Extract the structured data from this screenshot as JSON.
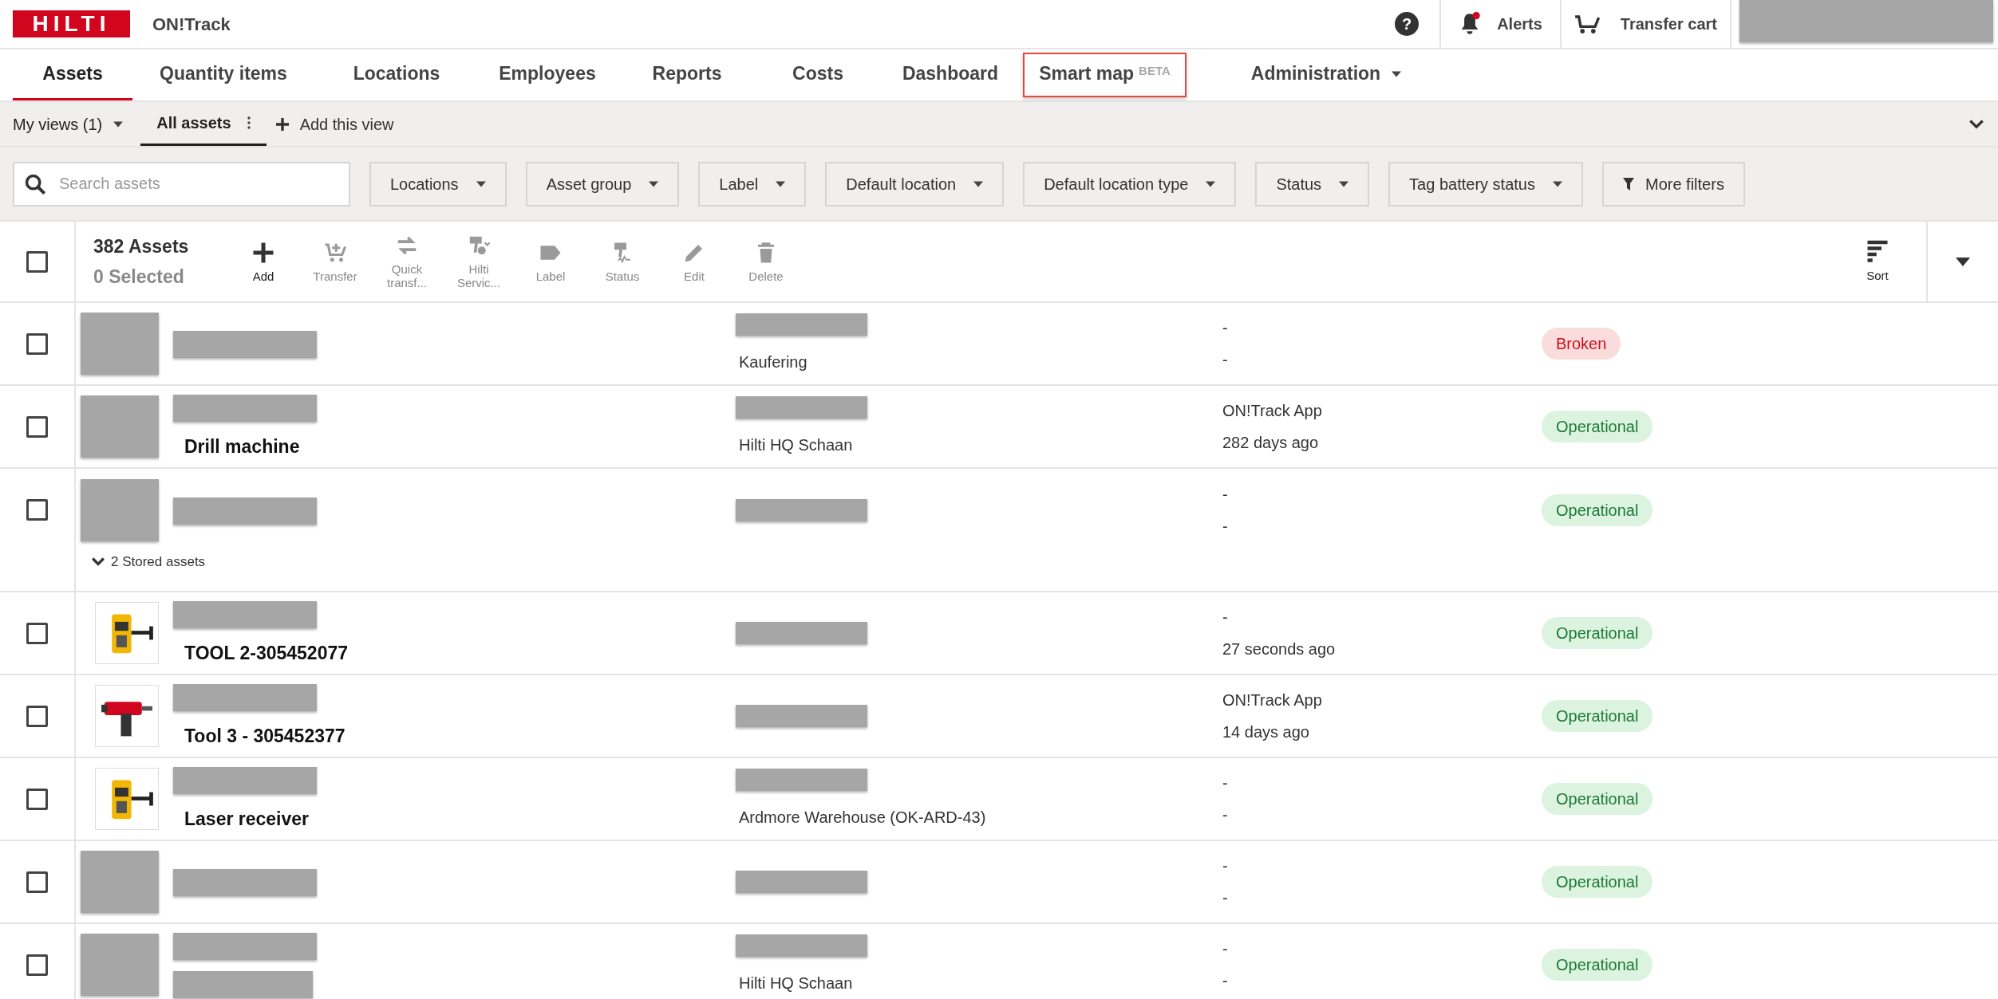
{
  "header": {
    "logo": "HILTI",
    "help": "?",
    "app_name": "ON!Track",
    "alerts": {
      "label": "Alerts",
      "unread": true
    },
    "transfer_cart": "Transfer cart",
    "user": {
      "kind": "redacted"
    }
  },
  "tabs": [
    {
      "label": "Assets",
      "selected": true
    },
    {
      "label": "Quantity items",
      "selected": false
    },
    {
      "label": "Locations",
      "selected": false
    },
    {
      "label": "Employees",
      "selected": false
    },
    {
      "label": "Reports",
      "selected": false
    },
    {
      "label": "Costs",
      "selected": false
    },
    {
      "label": "Dashboard",
      "selected": false
    },
    {
      "label": "Smart map",
      "badge": "BETA",
      "selected": false,
      "outlined": true
    },
    {
      "label": "Administration",
      "selected": false,
      "dropdown": true
    }
  ],
  "views": {
    "my_views": "My views (1)",
    "items": [
      {
        "label": "All assets",
        "selected": true
      }
    ],
    "add_view": "Add this view"
  },
  "filters": {
    "search": {
      "placeholder": "Search assets"
    },
    "dropdowns": [
      "Locations",
      "Asset group",
      "Label",
      "Default location",
      "Default location type",
      "Status",
      "Tag battery status"
    ],
    "more_filters": "More filters"
  },
  "toolbar": {
    "select_all": false,
    "count": "382 Assets",
    "selected_count": "0 Selected",
    "actions": [
      {
        "kind": "add",
        "label": "Add",
        "disabled": false
      },
      {
        "kind": "transfer",
        "label": "Transfer",
        "disabled": true
      },
      {
        "kind": "quick",
        "label": "Quick transf...",
        "disabled": true
      },
      {
        "kind": "service",
        "label": "Hilti Servic...",
        "disabled": true
      },
      {
        "kind": "label",
        "label": "Label",
        "disabled": true
      },
      {
        "kind": "status",
        "label": "Status",
        "disabled": true
      },
      {
        "kind": "edit",
        "label": "Edit",
        "disabled": true
      },
      {
        "kind": "delete",
        "label": "Delete",
        "disabled": true
      }
    ],
    "sort": "Sort"
  },
  "rows": [
    {
      "selected": false,
      "image": {
        "kind": "redacted"
      },
      "name": [
        {
          "kind": "redacted"
        }
      ],
      "location": [
        {
          "kind": "redacted"
        },
        {
          "kind": "text",
          "text": "Kaufering"
        }
      ],
      "info": [
        "-",
        "-"
      ],
      "status": {
        "text": "Broken",
        "kind": "broken"
      }
    },
    {
      "selected": false,
      "image": {
        "kind": "redacted"
      },
      "name": [
        {
          "kind": "redacted"
        },
        {
          "kind": "text",
          "text": "Drill machine"
        }
      ],
      "location": [
        {
          "kind": "redacted"
        },
        {
          "kind": "text",
          "text": "Hilti HQ Schaan"
        }
      ],
      "info": [
        "ON!Track App",
        "282 days ago"
      ],
      "status": {
        "text": "Operational",
        "kind": "operational"
      }
    },
    {
      "selected": false,
      "image": {
        "kind": "redacted"
      },
      "name": [
        {
          "kind": "redacted"
        }
      ],
      "location": [
        {
          "kind": "redacted"
        }
      ],
      "info": [
        "-",
        "-"
      ],
      "status": {
        "text": "Operational",
        "kind": "operational"
      },
      "stored_assets": {
        "label": "2 Stored assets",
        "expanded": false
      }
    },
    {
      "selected": false,
      "image": {
        "kind": "laser"
      },
      "name": [
        {
          "kind": "redacted"
        },
        {
          "kind": "text",
          "text": "TOOL 2-305452077"
        }
      ],
      "location": [
        {
          "kind": "redacted"
        }
      ],
      "info": [
        "-",
        "27 seconds ago"
      ],
      "status": {
        "text": "Operational",
        "kind": "operational"
      }
    },
    {
      "selected": false,
      "image": {
        "kind": "drill"
      },
      "name": [
        {
          "kind": "redacted"
        },
        {
          "kind": "text",
          "text": "Tool 3 - 305452377"
        }
      ],
      "location": [
        {
          "kind": "redacted"
        }
      ],
      "info": [
        "ON!Track App",
        "14 days ago"
      ],
      "status": {
        "text": "Operational",
        "kind": "operational"
      }
    },
    {
      "selected": false,
      "image": {
        "kind": "laser"
      },
      "name": [
        {
          "kind": "redacted"
        },
        {
          "kind": "text",
          "text": "Laser receiver"
        }
      ],
      "location": [
        {
          "kind": "redacted"
        },
        {
          "kind": "text",
          "text": "Ardmore Warehouse (OK-ARD-43)"
        }
      ],
      "info": [
        "-",
        "-"
      ],
      "status": {
        "text": "Operational",
        "kind": "operational"
      }
    },
    {
      "selected": false,
      "image": {
        "kind": "redacted"
      },
      "name": [
        {
          "kind": "redacted"
        }
      ],
      "location": [
        {
          "kind": "redacted"
        }
      ],
      "info": [
        "-",
        "-"
      ],
      "status": {
        "text": "Operational",
        "kind": "operational"
      }
    },
    {
      "selected": false,
      "image": {
        "kind": "redacted"
      },
      "name": [
        {
          "kind": "redacted"
        },
        {
          "kind": "redacted"
        }
      ],
      "location": [
        {
          "kind": "redacted"
        },
        {
          "kind": "text",
          "text": "Hilti HQ Schaan"
        }
      ],
      "info": [
        "-",
        "-"
      ],
      "status": {
        "text": "Operational",
        "kind": "operational"
      }
    }
  ]
}
